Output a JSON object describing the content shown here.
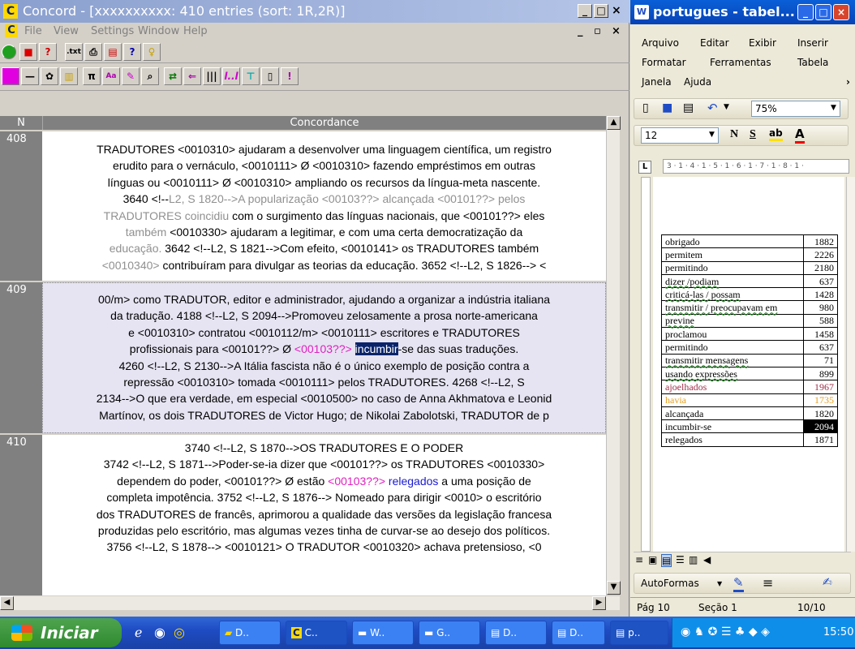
{
  "concord": {
    "title": "Concord - [xxxxxxxxxx: 410 entries (sort: 1R,2R)]",
    "menu": [
      "File",
      "View",
      "Settings",
      "Window",
      "Help"
    ],
    "col_n": "N",
    "col_concordance": "Concordance",
    "rows": [
      {
        "n": "408",
        "lines": [
          [
            {
              "t": "TRADUTORES  <0010310> ajudaram a desenvolver uma linguagem científica, um registro"
            }
          ],
          [
            {
              "t": "erudito para o vernáculo, <0010111> Ø <0010310>  fazendo empréstimos em outras"
            }
          ],
          [
            {
              "t": "línguas ou  <0010111> Ø <0010310> ampliando os recursos da língua-meta nascente."
            }
          ],
          [
            {
              "t": "3640 <!--"
            },
            {
              "t": "L2, S 1820-->A popularização  <00103??> alcançada <00101??>  pelos",
              "c": "gray"
            }
          ],
          [
            {
              "t": "TRADUTORES coincidiu",
              "c": "gray"
            },
            {
              "t": " com o surgimento das línguas nacionais, que  <00101??> eles"
            }
          ],
          [
            {
              "t": "também",
              "c": "gray"
            },
            {
              "t": "  <0010330> ajudaram a legitimar, e com uma certa democratização da"
            }
          ],
          [
            {
              "t": "educação.",
              "c": "gray"
            },
            {
              "t": "    3642 <!--L2, S 1821-->Com efeito, <0010141> os TRADUTORES também"
            }
          ],
          [
            {
              "t": "<0010340>",
              "c": "gray"
            },
            {
              "t": " contribuíram para divulgar as teorias da educação.    3652 <!--L2, S 1826--> <"
            }
          ]
        ]
      },
      {
        "n": "409",
        "lines": [
          [
            {
              "t": "00/m>  como TRADUTOR, editor e administrador, ajudando a organizar a indústria italiana"
            }
          ],
          [
            {
              "t": "da tradução.    4188 <!--L2, S 2094-->Promoveu zelosamente a prosa norte-americana"
            }
          ],
          [
            {
              "t": "e  <0010310> contratou  <0010112/m>  <0010111> escritores e TRADUTORES"
            }
          ],
          [
            {
              "t": "profissionais para <00101??> Ø "
            },
            {
              "t": "<00103??>",
              "c": "pink"
            },
            {
              "t": " "
            },
            {
              "t": "incumbir",
              "c": "hl"
            },
            {
              "t": "-se das suas traduções."
            }
          ],
          [
            {
              "t": "4260 <!--L2, S 2130-->A Itália fascista não é o único exemplo de posição contra a"
            }
          ],
          [
            {
              "t": "repressão  <0010310> tomada <0010111>  pelos TRADUTORES.    4268 <!--L2, S"
            }
          ],
          [
            {
              "t": "2134-->O que era verdade, em especial  <0010500> no caso de Anna Akhmatova e Leonid"
            }
          ],
          [
            {
              "t": "Martínov, os dois TRADUTORES de Victor Hugo; de Nikolai Zabolotski, TRADUTOR de p"
            }
          ]
        ]
      },
      {
        "n": "410",
        "lines": [
          [
            {
              "t": " "
            }
          ],
          [
            {
              "t": "3740 <!--L2, S 1870-->OS TRADUTORES E O PODER"
            }
          ],
          [
            {
              "t": "3742 <!--L2, S 1871-->Poder-se-ia dizer que  <00101??> os TRADUTORES  <0010330>"
            }
          ],
          [
            {
              "t": "dependem do poder, <00101??> Ø estão "
            },
            {
              "t": "<00103??>",
              "c": "pink"
            },
            {
              "t": "  "
            },
            {
              "t": "relegados",
              "c": "blue"
            },
            {
              "t": " a uma posição de"
            }
          ],
          [
            {
              "t": "completa impotência.    3752 <!--L2, S 1876--> Nomeado para dirigir  <0010> o escritório"
            }
          ],
          [
            {
              "t": "dos TRADUTORES de francês, aprimorou a qualidade das versões da legislação francesa"
            }
          ],
          [
            {
              "t": "produzidas pelo escritório, mas algumas vezes tinha de curvar-se ao desejo dos políticos."
            }
          ],
          [
            {
              "t": "3756 <!--L2, S 1878--> <0010121> O TRADUTOR <0010320>  achava pretensioso, <0"
            }
          ]
        ]
      }
    ]
  },
  "word": {
    "title": "portugues - tabel...",
    "menu": [
      "Arquivo",
      "Editar",
      "Exibir",
      "Inserir",
      "Formatar",
      "Ferramentas",
      "Tabela",
      "Janela",
      "Ajuda"
    ],
    "zoom": "75%",
    "font_size": "12",
    "ruler": "3 · 1 · 4 · 1 · 5 · 1 · 6 · 1 · 7 · 1 · 8 · 1 ·",
    "table": [
      {
        "word": "obrigado",
        "n": "1882",
        "color": "#000000"
      },
      {
        "word": "permitem",
        "n": "2226",
        "color": "#000000"
      },
      {
        "word": "permitindo",
        "n": "2180",
        "color": "#000000"
      },
      {
        "word": "dizer /podiam",
        "n": "637",
        "color": "#000000"
      },
      {
        "word": "criticá-las / possam",
        "n": "1428",
        "color": "#000000"
      },
      {
        "word": "transmitir / preocupavam em",
        "n": "980",
        "color": "#000000"
      },
      {
        "word": "previne",
        "n": "588",
        "color": "#000000"
      },
      {
        "word": "proclamou",
        "n": "1458",
        "color": "#000000"
      },
      {
        "word": "permitindo",
        "n": "637",
        "color": "#000000"
      },
      {
        "word": "transmitir mensagens",
        "n": "71",
        "color": "#000000"
      },
      {
        "word": "usando expressões",
        "n": "899",
        "color": "#000000"
      },
      {
        "word": "ajoelhados",
        "n": "1967",
        "color": "#a0304a"
      },
      {
        "word": "havia",
        "n": "1735",
        "color": "#e8a020"
      },
      {
        "word": "alcançada",
        "n": "1820",
        "color": "#000000"
      },
      {
        "word": "incumbir-se",
        "n": "2094",
        "color": "#000000"
      },
      {
        "word": "relegados",
        "n": "1871",
        "color": "#000000"
      }
    ],
    "autoformas": "AutoFormas",
    "status_page": "Pág 10",
    "status_section": "Seção 1",
    "status_pages": "10/10"
  },
  "taskbar": {
    "start": "Iniciar",
    "tasks": [
      "D..",
      "C..",
      "W..",
      "G..",
      "D..",
      "D..",
      "p.."
    ],
    "clock": "15:50"
  }
}
